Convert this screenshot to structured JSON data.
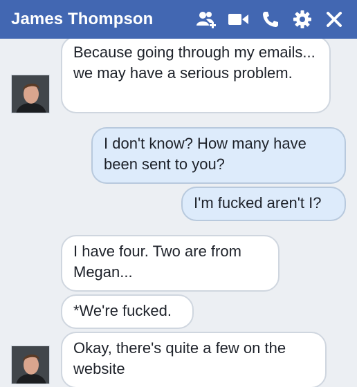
{
  "header": {
    "title": "James Thompson",
    "icons": [
      "add-friend-icon",
      "video-call-icon",
      "phone-call-icon",
      "gear-icon",
      "close-icon"
    ],
    "bg_color": "#4267b2"
  },
  "messages": [
    {
      "direction": "incoming",
      "text": "Because going through my emails... we may have a serious problem."
    },
    {
      "direction": "outgoing",
      "text": "I don't know? How many have been sent to you?"
    },
    {
      "direction": "outgoing",
      "text": "I'm fucked aren't I?"
    },
    {
      "direction": "incoming",
      "text": "I have four. Two are from Megan..."
    },
    {
      "direction": "incoming",
      "text": "*We're fucked."
    },
    {
      "direction": "incoming",
      "text": "Okay, there's quite a few on the website"
    }
  ],
  "colors": {
    "incoming_bubble": "#ffffff",
    "outgoing_bubble": "#ddebfb",
    "background": "#eceff3"
  }
}
